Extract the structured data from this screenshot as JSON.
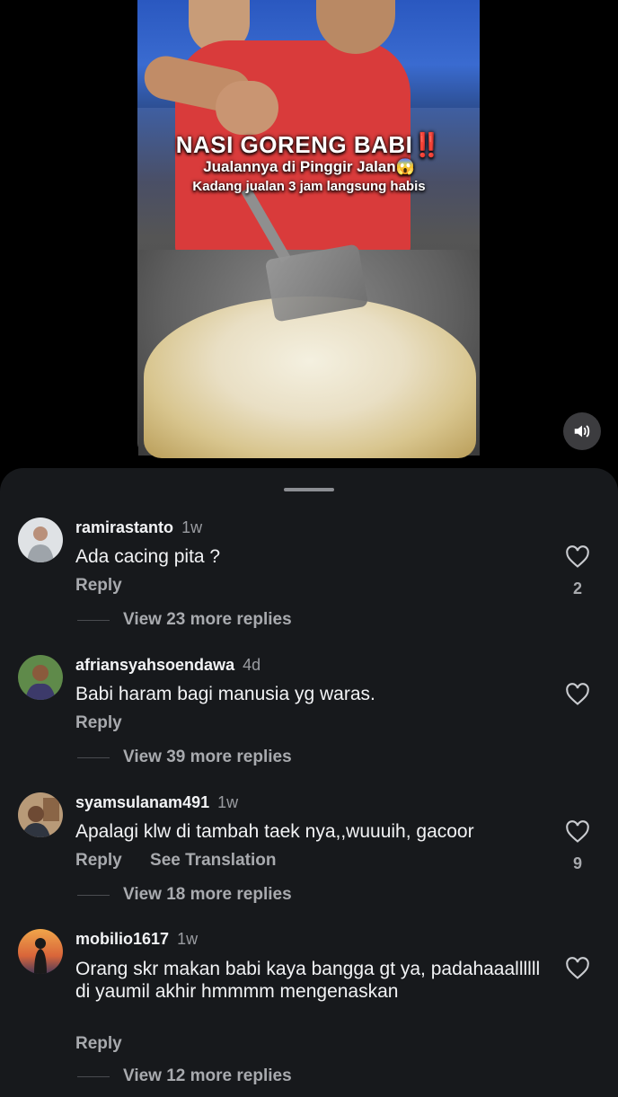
{
  "video": {
    "title": "NASI GORENG BABI",
    "title_mark": "‼️",
    "line2": "Jualannya di Pinggir Jalan😱",
    "line3": "Kadang jualan 3 jam langsung habis",
    "sound_icon": "speaker-icon"
  },
  "comments": [
    {
      "username": "ramirastanto",
      "time": "1w",
      "text": "Ada cacing pita ?",
      "actions": [
        "Reply"
      ],
      "likes": "2",
      "replies": "View 23 more replies",
      "avatar_color": "#c9cdd2"
    },
    {
      "username": "afriansyahsoendawa",
      "time": "4d",
      "text": "Babi haram bagi manusia yg waras.",
      "actions": [
        "Reply"
      ],
      "likes": "",
      "replies": "View 39 more replies",
      "avatar_color": "#4a7a3a"
    },
    {
      "username": "syamsulanam491",
      "time": "1w",
      "text": "Apalagi klw di tambah taek nya,,wuuuih, gacoor",
      "actions": [
        "Reply",
        "See Translation"
      ],
      "likes": "9",
      "replies": "View 18 more replies",
      "avatar_color": "#8a6b4a"
    },
    {
      "username": "mobilio1617",
      "time": "1w",
      "text": "Orang skr makan babi kaya bangga gt ya, padahaaallllll di yaumil akhir hmmmm mengenaskan",
      "actions": [
        "Reply"
      ],
      "likes": "",
      "replies": "View 12 more replies",
      "avatar_color": "#d98a3a"
    }
  ],
  "colors": {
    "sheet_bg": "#17191c",
    "text_primary": "#f2f3f5",
    "text_secondary": "#a8aaae"
  }
}
